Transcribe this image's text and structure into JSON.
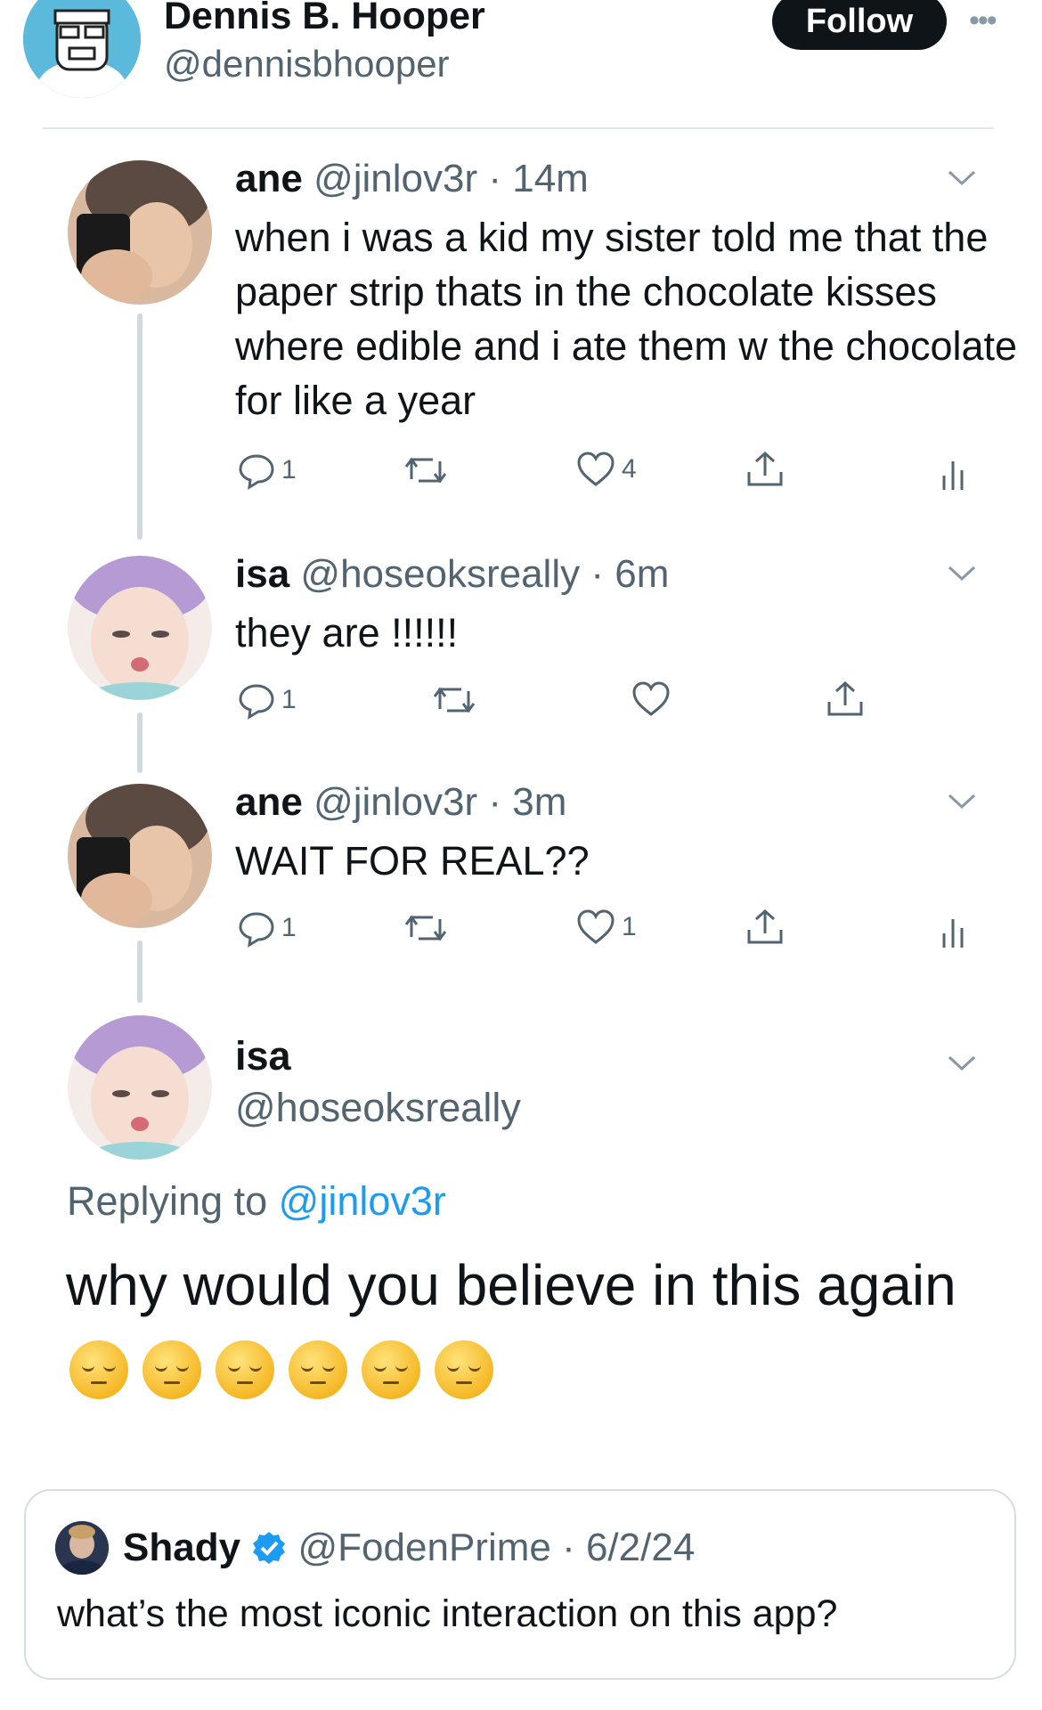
{
  "header": {
    "name": "Dennis B. Hooper",
    "handle": "@dennisbhooper",
    "follow_label": "Follow",
    "more_icon": "more-horizontal-icon"
  },
  "thread": [
    {
      "name": "ane",
      "handle": "@jinlov3r",
      "time": "· 14m",
      "text": "when i was a kid my sister told me that the paper strip thats in the chocolate kisses where edible and i ate them w the chocolate for like a year",
      "replies": "1",
      "likes": "4"
    },
    {
      "name": "isa",
      "handle": "@hoseoksreally",
      "time": "· 6m",
      "text": "they are !!!!!!",
      "replies": "1"
    },
    {
      "name": "ane",
      "handle": "@jinlov3r",
      "time": "· 3m",
      "text": "WAIT FOR REAL??",
      "replies": "1",
      "likes": "1"
    }
  ],
  "main_reply": {
    "name": "isa",
    "handle": "@hoseoksreally",
    "replying_prefix": "Replying to",
    "replying_mention": "@jinlov3r",
    "text": "why would you believe in this again",
    "emoji_count": 6
  },
  "quote": {
    "name": "Shady",
    "handle": "@FodenPrime",
    "date": "· 6/2/24",
    "text": "what’s the most iconic interaction on this app?",
    "verified_color": "#1d9bf0"
  },
  "colors": {
    "accent": "#1d9bf0",
    "text": "#0f1419",
    "muted": "#536471"
  }
}
